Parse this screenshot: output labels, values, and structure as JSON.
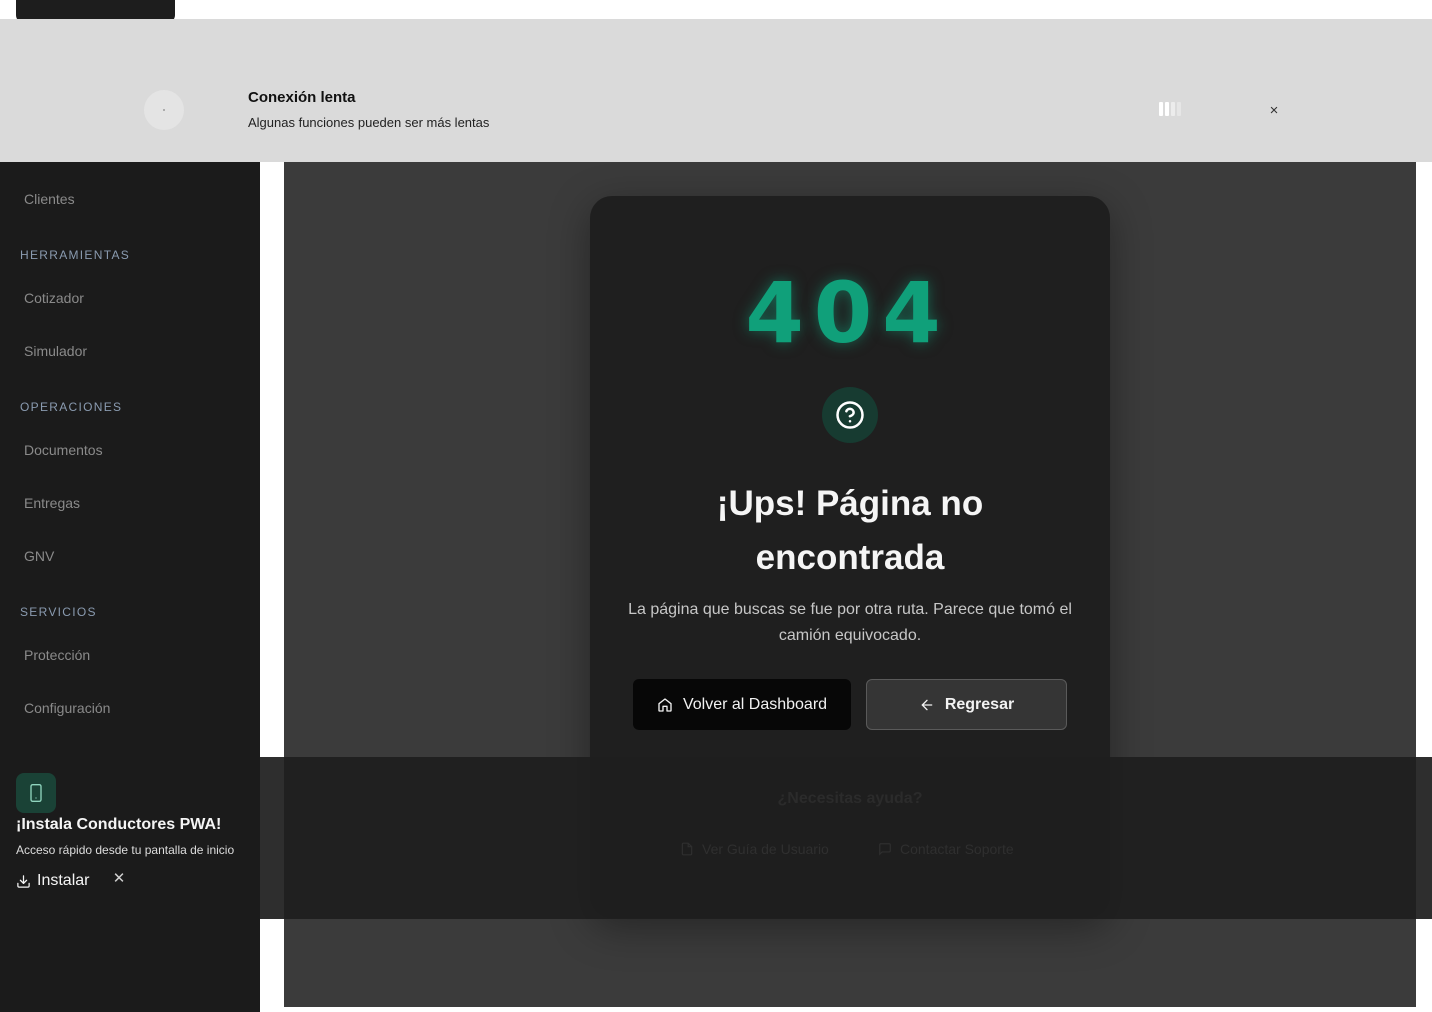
{
  "toast": {
    "title": "Conexión lenta",
    "subtitle": "Algunas funciones pueden ser más lentas",
    "close_label": "×",
    "signal_bars_active": 2,
    "signal_bars_total": 4
  },
  "sidebar": {
    "items": [
      {
        "type": "item",
        "label": "Clientes"
      },
      {
        "type": "section",
        "label": "HERRAMIENTAS"
      },
      {
        "type": "item",
        "label": "Cotizador"
      },
      {
        "type": "item",
        "label": "Simulador"
      },
      {
        "type": "section",
        "label": "OPERACIONES"
      },
      {
        "type": "item",
        "label": "Documentos"
      },
      {
        "type": "item",
        "label": "Entregas"
      },
      {
        "type": "item",
        "label": "GNV"
      },
      {
        "type": "section",
        "label": "SERVICIOS"
      },
      {
        "type": "item",
        "label": "Protección"
      },
      {
        "type": "item",
        "label": "Configuración"
      }
    ]
  },
  "error": {
    "code": "404",
    "icon": "help-circle-icon",
    "heading": "¡Ups! Página no encontrada",
    "description": "La página que buscas se fue por otra ruta. Parece que tomó el camión equivocado.",
    "primary_button": "Volver al Dashboard",
    "secondary_button": "Regresar"
  },
  "help": {
    "title": "¿Necesitas ayuda?",
    "guide_link": "Ver Guía de Usuario",
    "support_link": "Contactar Soporte"
  },
  "pwa": {
    "title": "¡Instala Conductores PWA!",
    "subtitle": "Acceso rápido desde tu pantalla de inicio",
    "install_label": "Instalar",
    "close_label": "✕"
  },
  "colors": {
    "accent": "#10a07a",
    "sidebar_bg": "#1b1b1b",
    "main_bg": "#3b3b3b",
    "card_bg": "#1f1f1f",
    "toast_bg": "#dadada"
  }
}
